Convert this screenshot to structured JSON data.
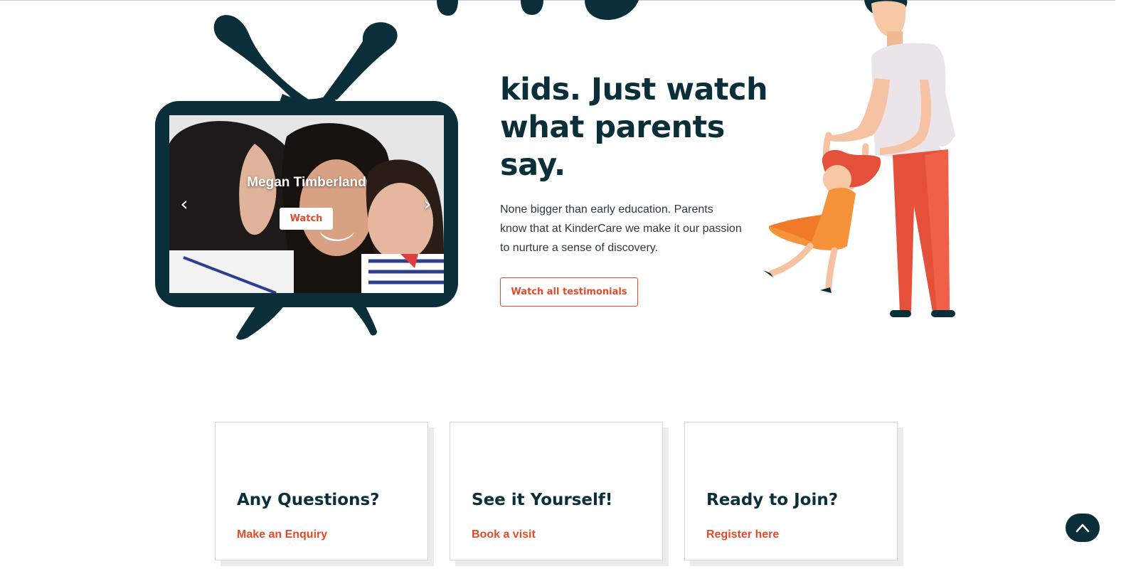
{
  "colors": {
    "navy": "#0b2f3a",
    "accent": "#e34a2a",
    "text": "#2b3a40",
    "card_shadow": "#ececec"
  },
  "testimonial_carousel": {
    "slide_name": "Megan Timberland",
    "watch_label": "Watch",
    "prev_icon": "chevron-left-icon",
    "next_icon": "chevron-right-icon"
  },
  "intro": {
    "headline": "kids. Just watch what parents say.",
    "body": "None bigger than early education. Parents know that at KinderCare we make it our pas­sion to nurture a sense of discovery.",
    "cta_label": "Watch all testimonials"
  },
  "cards": [
    {
      "title": "Any Questions?",
      "link": "Make an Enquiry"
    },
    {
      "title": "See it Yourself!",
      "link": "Book a visit"
    },
    {
      "title": "Ready to Join?",
      "link": "Register here"
    }
  ],
  "back_to_top": {
    "icon": "chevron-up-icon"
  }
}
